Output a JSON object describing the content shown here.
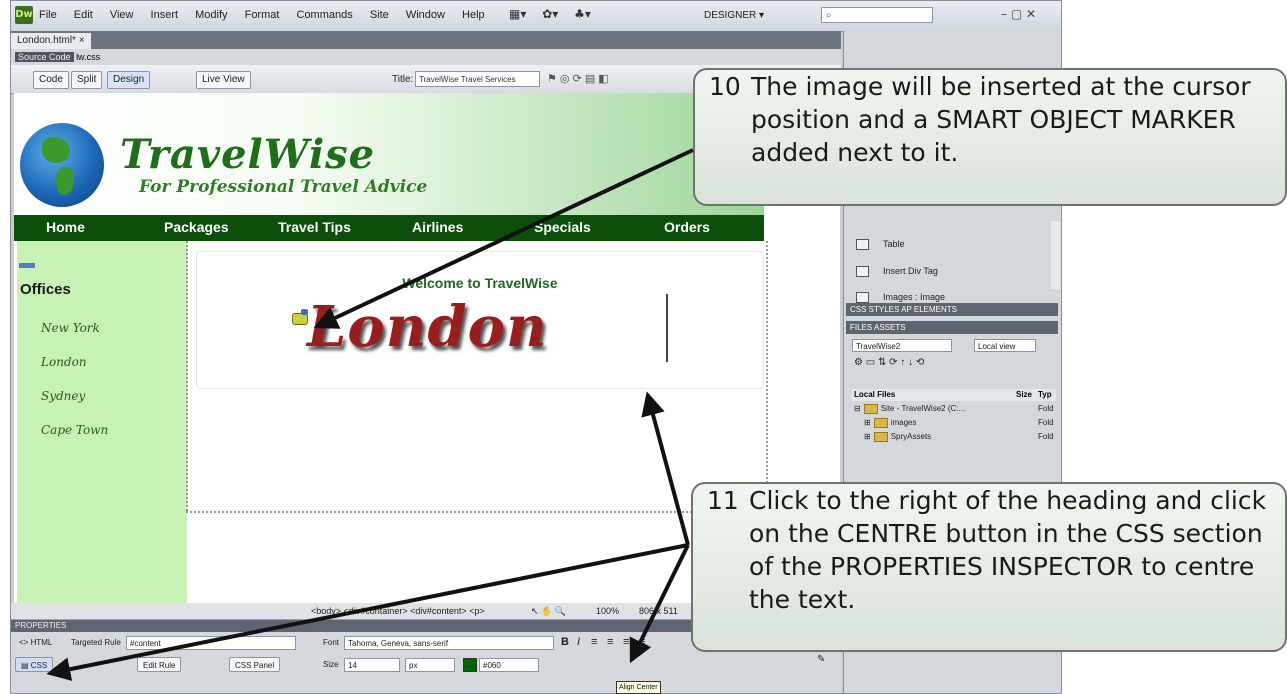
{
  "app": {
    "menus": [
      "File",
      "Edit",
      "View",
      "Insert",
      "Modify",
      "Format",
      "Commands",
      "Site",
      "Window",
      "Help"
    ],
    "workspace": "DESIGNER",
    "window_controls": "–  ▢  ✕"
  },
  "document": {
    "tab_label": "London.html* ×",
    "source_code_label": "Source Code",
    "related_file": "lw.css",
    "views": {
      "code": "Code",
      "split": "Split",
      "design": "Design",
      "live": "Live View"
    },
    "title_label": "Title:",
    "title_value": "TravelWise Travel Services"
  },
  "page": {
    "brand": "TravelWise",
    "tagline": "For Professional Travel Advice",
    "nav": [
      "Home",
      "Packages",
      "Travel Tips",
      "Airlines",
      "Specials",
      "Orders"
    ],
    "offices_heading": "Offices",
    "cities": [
      "New York",
      "London",
      "Sydney",
      "Cape Town"
    ],
    "welcome": "Welcome to TravelWise",
    "image_text": "London"
  },
  "insert_panel": {
    "items": [
      "Table",
      "Insert Div Tag",
      "Images : Image"
    ]
  },
  "css_panel": {
    "tabs": "CSS STYLES  AP ELEMENTS",
    "files_tab": "FILES  ASSETS",
    "site": "TravelWise2",
    "view": "Local view",
    "headers": {
      "name": "Local Files",
      "size": "Size",
      "type": "Typ"
    },
    "files": [
      {
        "name": "Site - TravelWise2 (C:...",
        "type": "Fold"
      },
      {
        "name": "images",
        "type": "Fold"
      },
      {
        "name": "SpryAssets",
        "type": "Fold"
      }
    ]
  },
  "status": {
    "tags": "<body> <div#container> <div#content> <p>",
    "zoom": "100%",
    "size": "806 x 511"
  },
  "properties": {
    "header": "PROPERTIES",
    "html_label": "HTML",
    "css_label": "CSS",
    "targeted_rule_label": "Targeted Rule",
    "targeted_rule_value": "#content",
    "edit_rule": "Edit Rule",
    "css_panel": "CSS Panel",
    "font_label": "Font",
    "font_value": "Tahoma, Geneva, sans-serif",
    "size_label": "Size",
    "size_value": "14",
    "size_unit": "px",
    "color_value": "#060",
    "tooltip": "Align Center"
  },
  "callouts": [
    {
      "num": "10",
      "text": "The image will be inserted at the cursor position and a SMART OBJECT MARKER added next to it."
    },
    {
      "num": "11",
      "text": "Click to the right of the heading and click on the CENTRE button in the CSS section of the PROPERTIES INSPECTOR to centre the text."
    }
  ]
}
